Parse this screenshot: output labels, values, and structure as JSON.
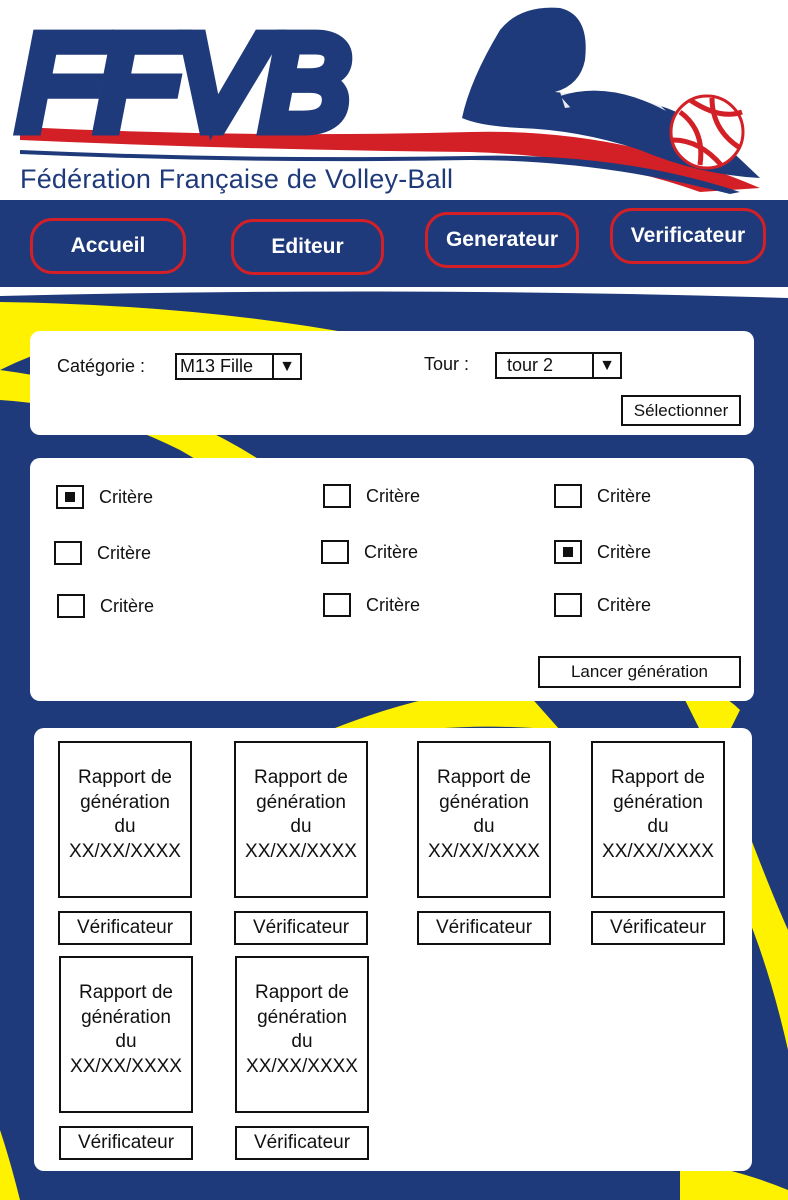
{
  "brand": {
    "logo_text": "FFVB",
    "federation_name": "Fédération Française de Volley-Ball",
    "colors": {
      "blue": "#1f3a7a",
      "red": "#d32027",
      "yellow": "#fff200",
      "white": "#ffffff"
    }
  },
  "nav": {
    "items": [
      {
        "label": "Accueil"
      },
      {
        "label": "Editeur"
      },
      {
        "label": "Generateur"
      },
      {
        "label": "Verificateur"
      }
    ]
  },
  "filters": {
    "category_label": "Catégorie :",
    "category_value": "M13 Fille",
    "round_label": "Tour :",
    "round_value": "tour 2",
    "dropdown_icon": "triangle-down-icon",
    "select_button": "Sélectionner"
  },
  "criteria": {
    "items": [
      {
        "label": "Critère",
        "checked": true
      },
      {
        "label": "Critère",
        "checked": false
      },
      {
        "label": "Critère",
        "checked": false
      },
      {
        "label": "Critère",
        "checked": false
      },
      {
        "label": "Critère",
        "checked": false
      },
      {
        "label": "Critère",
        "checked": true
      },
      {
        "label": "Critère",
        "checked": false
      },
      {
        "label": "Critère",
        "checked": false
      },
      {
        "label": "Critère",
        "checked": false
      }
    ],
    "launch_button": "Lancer génération"
  },
  "reports": {
    "items": [
      {
        "line1": "Rapport de",
        "line2": "génération",
        "line3": "du",
        "line4": "XX/XX/XXXX",
        "button": "Vérificateur"
      },
      {
        "line1": "Rapport de",
        "line2": "génération",
        "line3": "du",
        "line4": "XX/XX/XXXX",
        "button": "Vérificateur"
      },
      {
        "line1": "Rapport de",
        "line2": "génération",
        "line3": "du",
        "line4": "XX/XX/XXXX",
        "button": "Vérificateur"
      },
      {
        "line1": "Rapport de",
        "line2": "génération",
        "line3": "du",
        "line4": "XX/XX/XXXX",
        "button": "Vérificateur"
      },
      {
        "line1": "Rapport de",
        "line2": "génération",
        "line3": "du",
        "line4": "XX/XX/XXXX",
        "button": "Vérificateur"
      },
      {
        "line1": "Rapport de",
        "line2": "génération",
        "line3": "du",
        "line4": "XX/XX/XXXX",
        "button": "Vérificateur"
      }
    ]
  }
}
